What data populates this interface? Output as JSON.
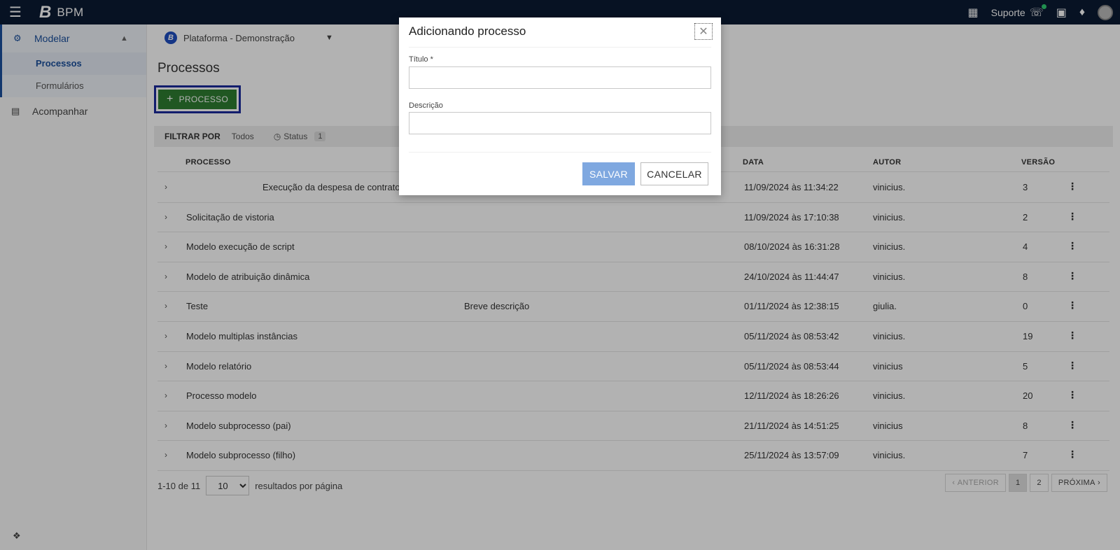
{
  "topbar": {
    "app_name": "BPM",
    "logo_letter": "B",
    "support_label": "Suporte"
  },
  "sidebar": {
    "group_label": "Modelar",
    "items": [
      {
        "label": "Processos",
        "active": true
      },
      {
        "label": "Formulários",
        "active": false
      }
    ],
    "follow_label": "Acompanhar"
  },
  "platform": {
    "badge": "B",
    "name": "Plataforma - Demonstração"
  },
  "page": {
    "title": "Processos",
    "add_button": "PROCESSO"
  },
  "filter": {
    "label": "FILTRAR POR",
    "all": "Todos",
    "status": "Status",
    "status_count": "1"
  },
  "table": {
    "headers": {
      "process": "PROCESSO",
      "date": "DATA",
      "author": "AUTOR",
      "version": "VERSÃO"
    },
    "rows": [
      {
        "name": "",
        "description": "Execução da despesa de contrato",
        "date": "11/09/2024 às 11:34:22",
        "author": "vinicius.",
        "version": "3"
      },
      {
        "name": "Solicitação de vistoria",
        "description": "",
        "date": "11/09/2024 às 17:10:38",
        "author": "vinicius.",
        "version": "2"
      },
      {
        "name": "Modelo execução de script",
        "description": "",
        "date": "08/10/2024 às 16:31:28",
        "author": "vinicius.",
        "version": "4"
      },
      {
        "name": "Modelo de atribuição dinâmica",
        "description": "",
        "date": "24/10/2024 às 11:44:47",
        "author": "vinicius.",
        "version": "8"
      },
      {
        "name": "Teste",
        "description": "Breve descrição",
        "date": "01/11/2024 às 12:38:15",
        "author": "giulia.",
        "version": "0"
      },
      {
        "name": "Modelo multiplas instâncias",
        "description": "",
        "date": "05/11/2024 às 08:53:42",
        "author": "vinicius.",
        "version": "19"
      },
      {
        "name": "Modelo relatório",
        "description": "",
        "date": "05/11/2024 às 08:53:44",
        "author": "vinicius",
        "version": "5"
      },
      {
        "name": "Processo modelo",
        "description": "",
        "date": "12/11/2024 às 18:26:26",
        "author": "vinicius.",
        "version": "20"
      },
      {
        "name": "Modelo subprocesso (pai)",
        "description": "",
        "date": "21/11/2024 às 14:51:25",
        "author": "vinicius",
        "version": "8"
      },
      {
        "name": "Modelo subprocesso (filho)",
        "description": "",
        "date": "25/11/2024 às 13:57:09",
        "author": "vinicius.",
        "version": "7"
      }
    ]
  },
  "pagination": {
    "range": "1-10 de 11",
    "per_page": "10",
    "per_page_label": "resultados por página",
    "prev": "ANTERIOR",
    "pages": [
      "1",
      "2"
    ],
    "next": "PRÓXIMA"
  },
  "modal": {
    "title": "Adicionando processo",
    "title_field_label": "Título *",
    "title_field_value": "",
    "description_field_label": "Descrição",
    "description_field_value": "",
    "save": "SALVAR",
    "cancel": "CANCELAR"
  },
  "colors": {
    "topbar": "#0b1a33",
    "add_button": "#2e7d32",
    "save_button": "#7fa8e0",
    "sidebar_accent": "#1a4f9c"
  }
}
